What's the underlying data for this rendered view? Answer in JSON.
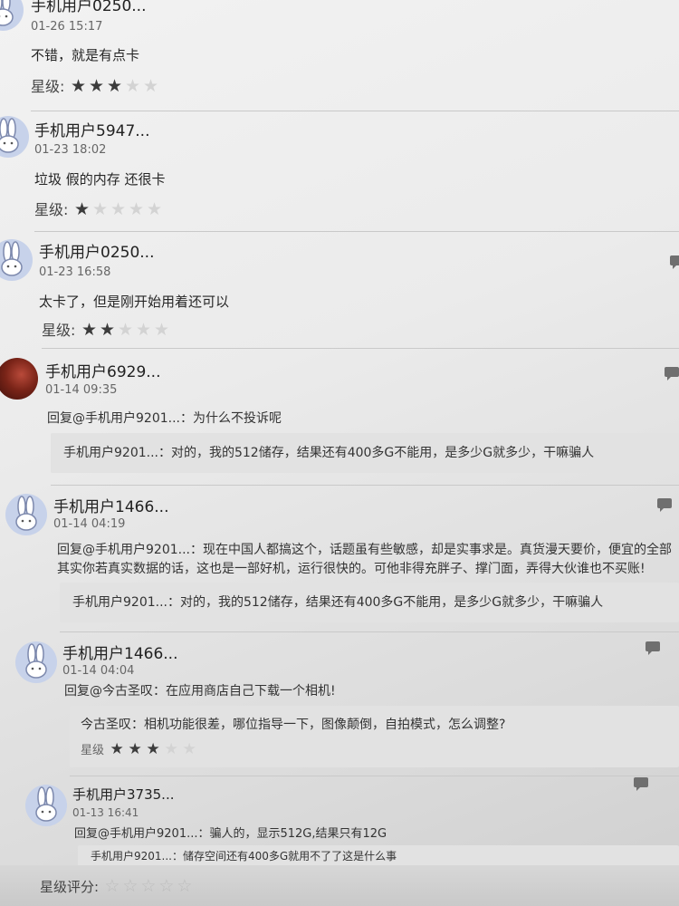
{
  "reviews": [
    {
      "user": "手机用户0250...",
      "time": "01-26 15:17",
      "text": "不错，就是有点卡",
      "rating_label": "星级:",
      "rating": 3
    },
    {
      "user": "手机用户5947...",
      "time": "01-23 18:02",
      "text": "垃圾 假的内存 还很卡",
      "rating_label": "星级:",
      "rating": 1
    },
    {
      "user": "手机用户0250...",
      "time": "01-23 16:58",
      "text": "太卡了，但是刚开始用着还可以",
      "rating_label": "星级:",
      "rating": 2
    },
    {
      "user": "手机用户6929...",
      "time": "01-14 09:35",
      "reply": "回复@手机用户9201...：为什么不投诉呢",
      "quote": "手机用户9201...：对的，我的512储存，结果还有400多G不能用，是多少G就多少，干嘛骗人"
    },
    {
      "user": "手机用户1466...",
      "time": "01-14 04:19",
      "reply_line1": "回复@手机用户9201...：现在中国人都搞这个，话题虽有些敏感，却是实事求是。真货漫天要价，便宜的全部",
      "reply_line2": "其实你若真实数据的话，这也是一部好机，运行很快的。可他非得充胖子、撑门面，弄得大伙谁也不买账!",
      "quote": "手机用户9201...：对的，我的512储存，结果还有400多G不能用，是多少G就多少，干嘛骗人"
    },
    {
      "user": "手机用户1466...",
      "time": "01-14 04:04",
      "reply": "回复@今古圣叹：在应用商店自己下载一个相机!",
      "quote": "今古圣叹：相机功能很差，哪位指导一下，图像颠倒，自拍模式，怎么调整?",
      "quote_rating_label": "星级",
      "quote_rating": 3
    },
    {
      "user": "手机用户3735...",
      "time": "01-13 16:41",
      "reply": "回复@手机用户9201...：骗人的，显示512G,结果只有12G",
      "quote": "手机用户9201...：储存空间还有400多G就用不了了这是什么事"
    }
  ],
  "footer": {
    "rating_label": "星级评分:"
  }
}
